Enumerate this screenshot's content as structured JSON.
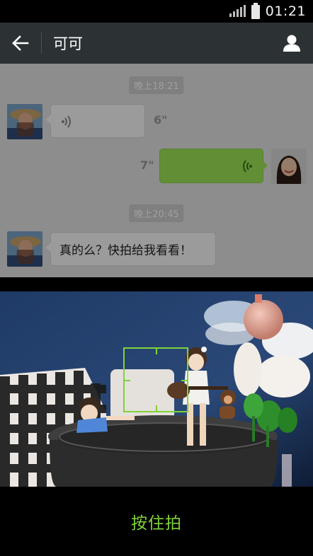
{
  "status_bar": {
    "time": "01:21"
  },
  "header": {
    "title": "可可"
  },
  "chat": {
    "messages": [
      {
        "type": "time",
        "text": "晚上18:21"
      },
      {
        "type": "voice",
        "side": "left",
        "duration": "6\""
      },
      {
        "type": "voice",
        "side": "right",
        "duration": "7\""
      },
      {
        "type": "time",
        "text": "晚上20:45"
      },
      {
        "type": "text",
        "side": "left",
        "text": "真的么？快拍给我看看！"
      }
    ]
  },
  "camera": {
    "hold_label": "按住拍"
  },
  "colors": {
    "accent_green": "#7fd33a",
    "bubble_out": "#9fe658",
    "header_bg": "#2c3234"
  },
  "icons": {
    "back": "arrow-left-icon",
    "profile": "person-icon",
    "voice_in": "sound-wave-icon",
    "voice_out": "sound-wave-icon"
  }
}
